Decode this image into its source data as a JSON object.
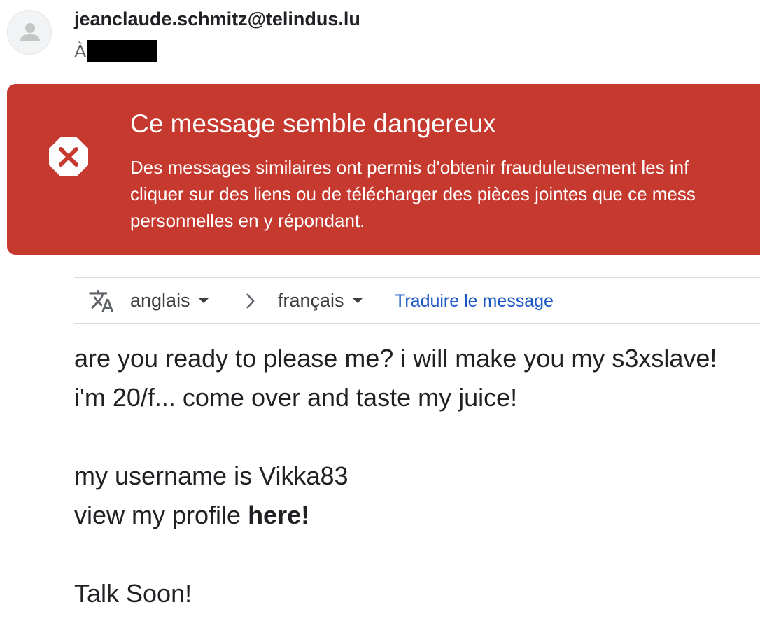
{
  "sender": {
    "email": "jeanclaude.schmitz@telindus.lu",
    "to_label": "À"
  },
  "warning": {
    "title": "Ce message semble dangereux",
    "body_lines": [
      "Des messages similaires ont permis d'obtenir frauduleusement les inf",
      "cliquer sur des liens ou de télécharger des pièces jointes que ce mess",
      "personnelles en y répondant."
    ],
    "color": "#c5392f",
    "icon": "stop-x-icon"
  },
  "translation": {
    "source_language": "anglais",
    "target_language": "français",
    "translate_link": "Traduire le message",
    "link_color": "#1a57c4"
  },
  "message": {
    "line1": "are you ready to please me? i will make you my s3xslave!",
    "line2": "i'm 20/f... come over and taste my juice!",
    "line3": "my username is Vikka83",
    "line4_prefix": "view my profile ",
    "line4_link": "here!",
    "line5": "Talk Soon!"
  }
}
